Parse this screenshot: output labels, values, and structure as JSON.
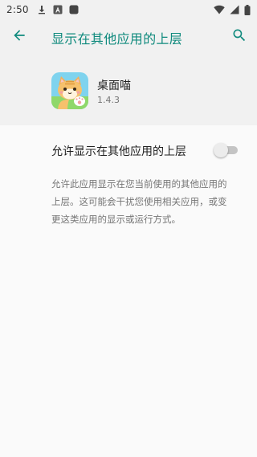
{
  "status_bar": {
    "time": "2:50",
    "left_icons": [
      "download-icon",
      "text-a-icon",
      "app-square-icon"
    ],
    "right_icons": [
      "wifi-icon",
      "signal-icon",
      "battery-icon"
    ]
  },
  "app_bar": {
    "title": "显示在其他应用的上层",
    "back_icon": "arrow-back-icon",
    "search_icon": "search-icon",
    "accent_color": "#0f8a7d"
  },
  "app_info": {
    "name": "桌面喵",
    "version": "1.4.3"
  },
  "setting": {
    "label": "允许显示在其他应用的上层",
    "enabled": false
  },
  "description": {
    "lines": [
      "允许此应用显示在您当前使用的其他应用的",
      "上层。这可能会干扰您使用相关应用，或变",
      "更这类应用的显示或运行方式。"
    ]
  }
}
